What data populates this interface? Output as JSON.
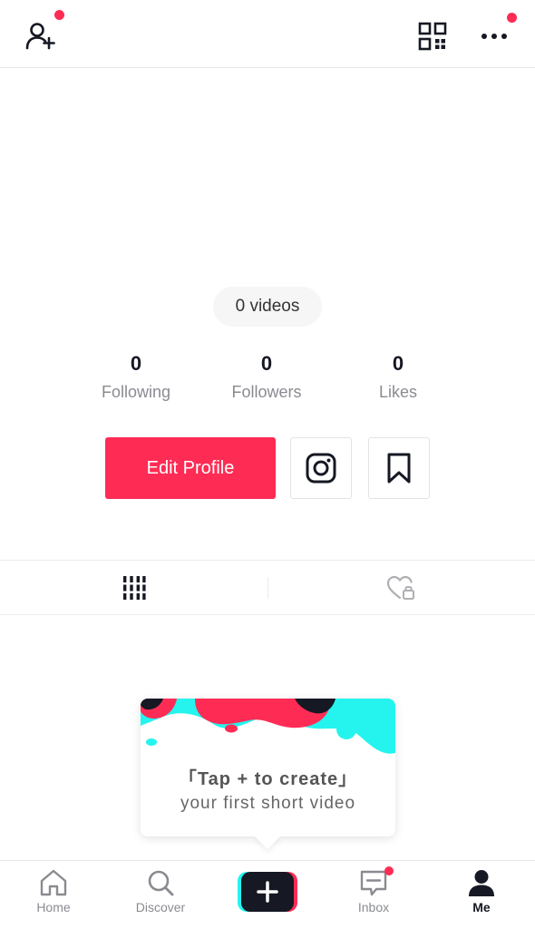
{
  "colors": {
    "accent": "#fe2c55",
    "cyan": "#25f4ee",
    "text": "#161823",
    "muted": "#8a8b91"
  },
  "topbar": {
    "left_icon": "add-user-icon",
    "qr_icon": "qr-code-icon",
    "more_icon": "more-icon"
  },
  "profile": {
    "video_count": "0 videos",
    "stats": [
      {
        "value": "0",
        "label": "Following"
      },
      {
        "value": "0",
        "label": "Followers"
      },
      {
        "value": "0",
        "label": "Likes"
      }
    ],
    "edit_label": "Edit Profile",
    "instagram_icon": "instagram-icon",
    "bookmark_icon": "bookmark-icon"
  },
  "tabs": [
    {
      "icon": "grid-icon"
    },
    {
      "icon": "liked-private-icon"
    }
  ],
  "create_card": {
    "title": "「Tap + to create」",
    "subtitle": "your first short video"
  },
  "bottomnav": {
    "items": [
      {
        "label": "Home",
        "icon": "home-icon"
      },
      {
        "label": "Discover",
        "icon": "search-icon"
      },
      {
        "label": "",
        "icon": "plus-icon"
      },
      {
        "label": "Inbox",
        "icon": "inbox-icon"
      },
      {
        "label": "Me",
        "icon": "profile-icon"
      }
    ]
  }
}
